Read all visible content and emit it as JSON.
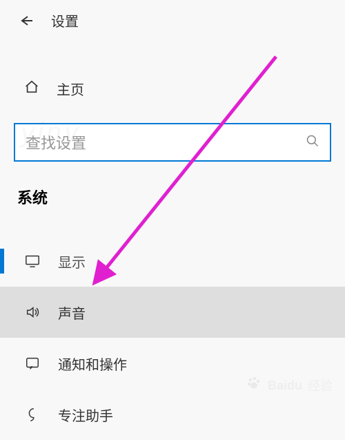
{
  "header": {
    "title": "设置"
  },
  "home": {
    "label": "主页"
  },
  "search": {
    "placeholder": "查找设置"
  },
  "section": {
    "title": "系统"
  },
  "nav": {
    "display": "显示",
    "sound": "声音",
    "notifications": "通知和操作",
    "focus": "专注助手"
  },
  "watermark": {
    "brand": "Baidu",
    "sub": "经验"
  }
}
